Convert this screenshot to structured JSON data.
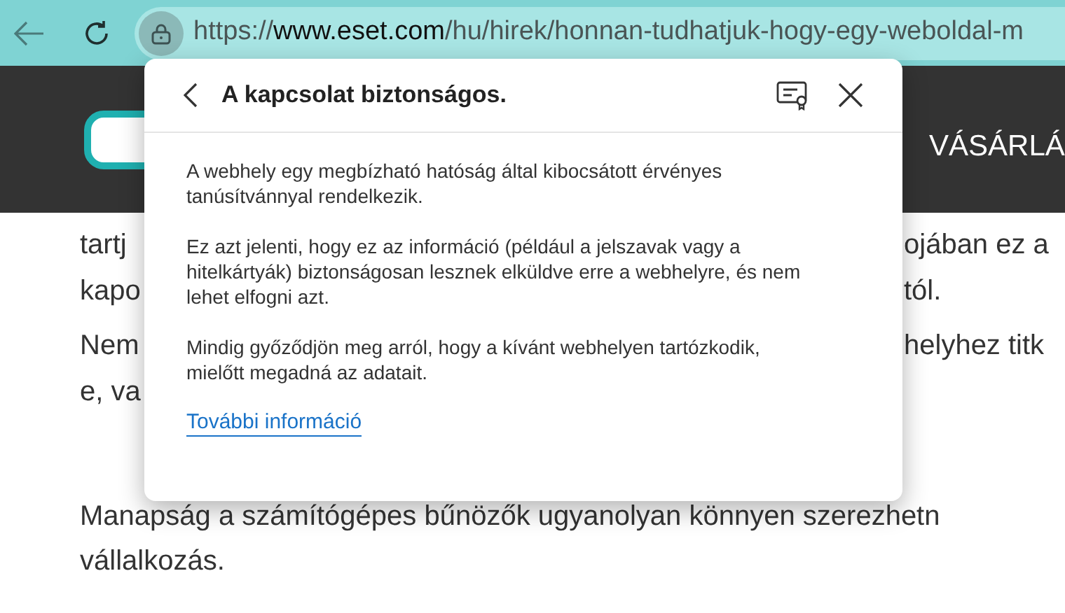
{
  "browser": {
    "url_host_prefix": "https://",
    "url_host": "www.eset.com",
    "url_path": "/hu/hirek/honnan-tudhatjuk-hogy-egy-weboldal-m"
  },
  "site_header": {
    "nav_item": "VÁSÁRLÁ"
  },
  "page_text": [
    {
      "left": "tartj",
      "right": "ojában ez a"
    },
    {
      "left": "kapo",
      "right": "tól."
    },
    {
      "left": "Nem",
      "right": "helyhez titk"
    },
    {
      "left": "e, va"
    }
  ],
  "page_paragraph": [
    "Manapság a számítógépes bűnözők ugyanolyan könnyen szerezhetn",
    "vállalkozás."
  ],
  "popup": {
    "title": "A kapcsolat biztonságos.",
    "paragraphs": [
      "A webhely egy megbízható hatóság által kibocsátott érvényes tanúsítvánnyal rendelkezik.",
      "Ez azt jelenti, hogy ez az információ (például a jelszavak vagy a hitelkártyák) biztonságosan lesznek elküldve erre a webhelyre, és nem lehet elfogni azt.",
      "Mindig győződjön meg arról, hogy a kívánt webhelyen tartózkodik, mielőtt megadná az adatait."
    ],
    "link": "További információ"
  }
}
